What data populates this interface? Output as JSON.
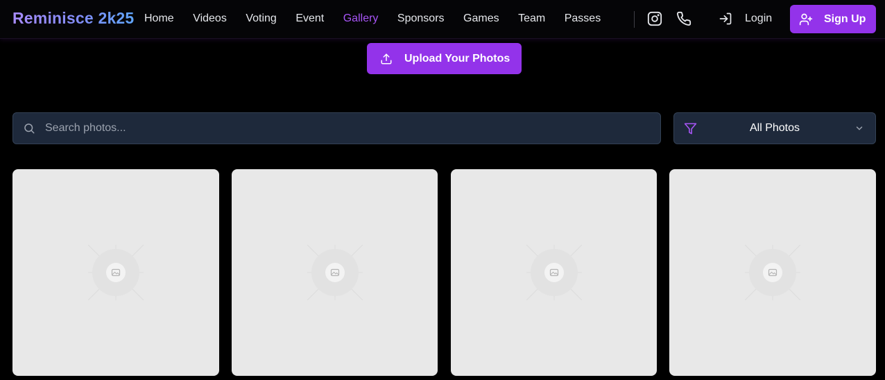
{
  "brand": {
    "name": "Reminisce 2k25"
  },
  "nav": {
    "links": [
      "Home",
      "Videos",
      "Voting",
      "Event",
      "Gallery",
      "Sponsors",
      "Games",
      "Team",
      "Passes"
    ],
    "active": "Gallery",
    "icons": [
      "instagram-icon",
      "phone-icon"
    ],
    "login_label": "Login",
    "signup_label": "Sign Up"
  },
  "upload": {
    "label": "Upload Your Photos",
    "icon": "upload-icon"
  },
  "search": {
    "placeholder": "Search photos...",
    "value": "",
    "icon": "search-icon"
  },
  "filter": {
    "selected": "All Photos",
    "icon": "filter-icon"
  },
  "gallery": {
    "photos": [
      {
        "state": "loading",
        "icon": "image-placeholder-icon"
      },
      {
        "state": "loading",
        "icon": "image-placeholder-icon"
      },
      {
        "state": "loading",
        "icon": "image-placeholder-icon"
      },
      {
        "state": "loading",
        "icon": "image-placeholder-icon"
      }
    ]
  },
  "colors": {
    "accent": "#9333ea",
    "active_link": "#a855f7",
    "input_bg": "#1e293b",
    "page_bg": "#000000",
    "card_bg": "#e8e8e8"
  }
}
